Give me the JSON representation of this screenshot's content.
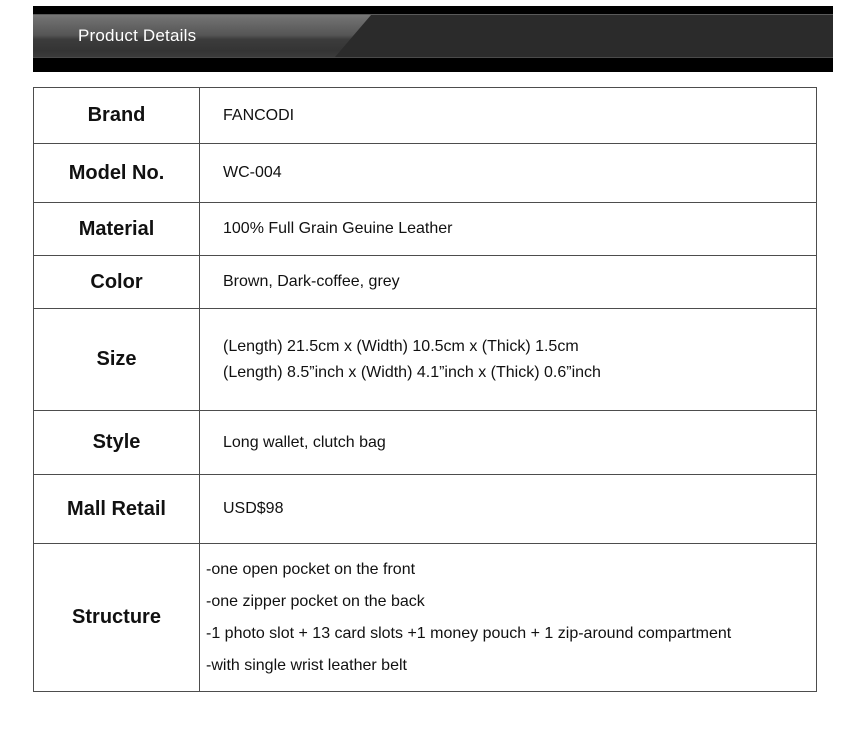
{
  "header": {
    "title": "Product Details"
  },
  "table": {
    "rows": [
      {
        "label": "Brand",
        "value": "FANCODI"
      },
      {
        "label": "Model No.",
        "value": "WC-004"
      },
      {
        "label": "Material",
        "value": "100% Full Grain  Geuine Leather"
      },
      {
        "label": "Color",
        "value": "Brown, Dark-coffee, grey"
      },
      {
        "label": "Size",
        "lines": [
          "(Length) 21.5cm x (Width) 10.5cm x (Thick) 1.5cm",
          "(Length) 8.5”inch x (Width) 4.1”inch x (Thick) 0.6”inch"
        ]
      },
      {
        "label": "Style",
        "value": "Long wallet, clutch bag"
      },
      {
        "label": "Mall Retail",
        "value": "USD$98"
      },
      {
        "label": "Structure",
        "lines": [
          "-one open pocket on the front",
          "-one zipper pocket on the back",
          "-1 photo slot + 13 card slots +1 money pouch + 1 zip-around compartment",
          "-with single wrist leather belt"
        ]
      }
    ]
  },
  "colors": {
    "banner_black": "#000000",
    "banner_dark": "#2b2b2b",
    "tab_gradient_top": "#787878",
    "tab_gradient_bottom": "#343434",
    "title_text": "#ffffff",
    "table_border": "#4d4d4d",
    "table_text": "#111111",
    "page_background": "#ffffff"
  }
}
